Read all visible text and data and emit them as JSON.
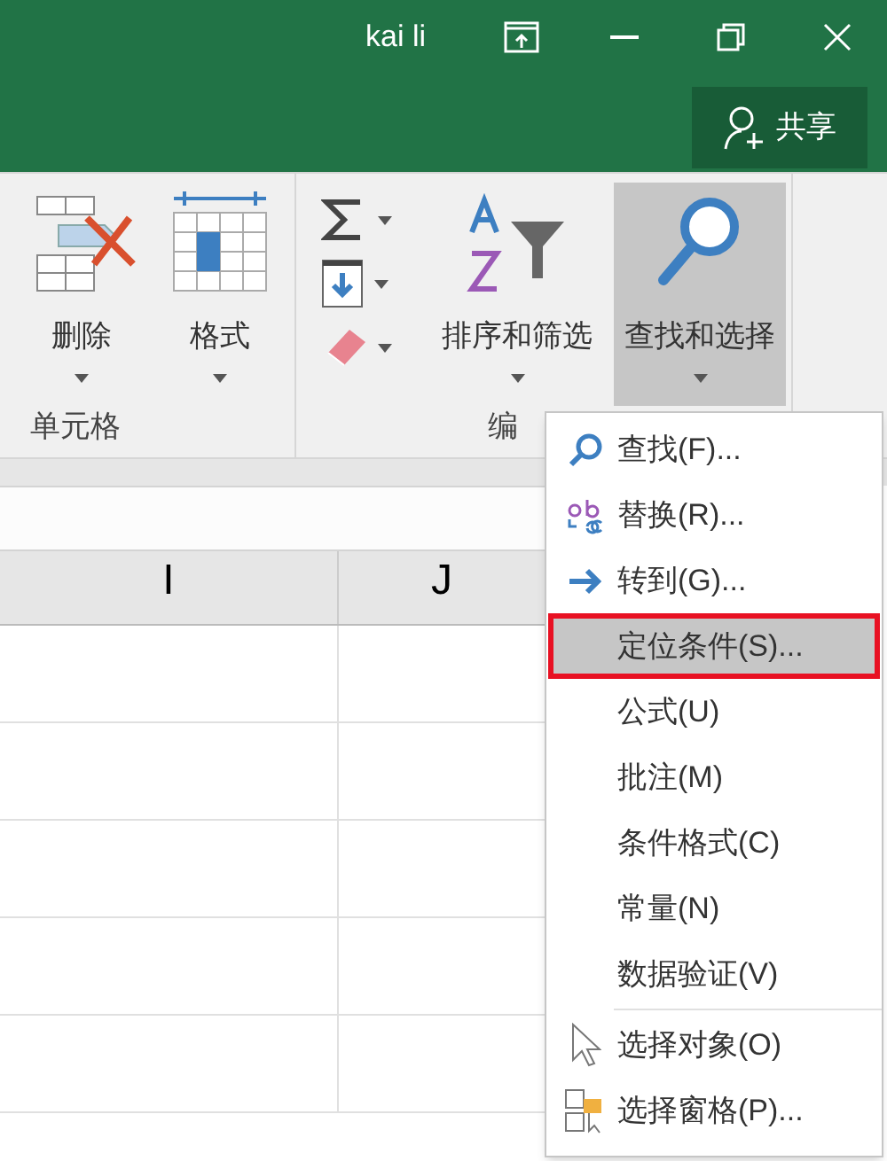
{
  "window": {
    "user": "kai li",
    "share_button": "共享"
  },
  "ribbon": {
    "groups": [
      {
        "kind": "cells",
        "label": "单元格",
        "buttons": [
          {
            "label": "删除",
            "pressed": false
          },
          {
            "label": "格式",
            "pressed": false
          }
        ]
      },
      {
        "kind": "editing",
        "label": "编",
        "buttons": [
          {
            "label": "排序和筛选",
            "pressed": false
          },
          {
            "label": "查找和选择",
            "pressed": true
          }
        ]
      }
    ]
  },
  "sheet": {
    "columns": [
      {
        "label": "I"
      },
      {
        "label": "J"
      }
    ]
  },
  "menu": {
    "items": [
      {
        "label": "查找(F)...",
        "selected": false,
        "separator_before": false
      },
      {
        "label": "替换(R)...",
        "selected": false,
        "separator_before": false
      },
      {
        "label": "转到(G)...",
        "selected": false,
        "separator_before": false
      },
      {
        "label": "定位条件(S)...",
        "selected": true,
        "separator_before": false
      },
      {
        "label": "公式(U)",
        "selected": false,
        "separator_before": false
      },
      {
        "label": "批注(M)",
        "selected": false,
        "separator_before": false
      },
      {
        "label": "条件格式(C)",
        "selected": false,
        "separator_before": false
      },
      {
        "label": "常量(N)",
        "selected": false,
        "separator_before": false
      },
      {
        "label": "数据验证(V)",
        "selected": false,
        "separator_before": false
      },
      {
        "label": "选择对象(O)",
        "selected": false,
        "separator_before": true
      },
      {
        "label": "选择窗格(P)...",
        "selected": false,
        "separator_before": false
      }
    ]
  }
}
